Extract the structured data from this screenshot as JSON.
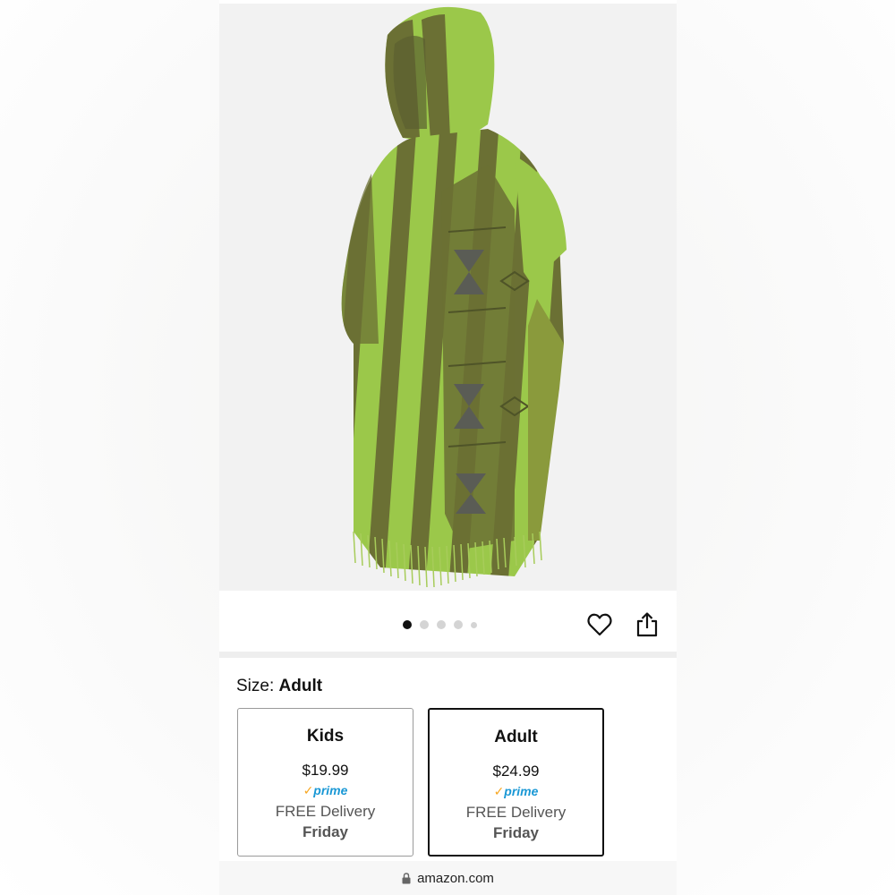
{
  "product_image": {
    "subject": "green-striped-hooded-poncho",
    "colors": {
      "light_green": "#9bc84a",
      "olive": "#6b7034",
      "dark_olive": "#4f5428",
      "pattern_gray": "#5a5c55"
    }
  },
  "carousel": {
    "total": 5,
    "active_index": 0
  },
  "actions": {
    "wishlist_icon": "heart-icon",
    "share_icon": "share-icon"
  },
  "size": {
    "label": "Size:",
    "selected": "Adult"
  },
  "options": [
    {
      "name": "Kids",
      "price": "$19.99",
      "prime_check": "✓",
      "prime": "prime",
      "delivery": "FREE Delivery",
      "day": "Friday",
      "selected": false
    },
    {
      "name": "Adult",
      "price": "$24.99",
      "prime_check": "✓",
      "prime": "prime",
      "delivery": "FREE Delivery",
      "day": "Friday",
      "selected": true
    }
  ],
  "browser": {
    "lock_icon": "lock-icon",
    "url": "amazon.com"
  },
  "colors": {
    "prime_blue": "#1a98d5",
    "prime_check": "#f7a721",
    "selected_border": "#111111"
  }
}
